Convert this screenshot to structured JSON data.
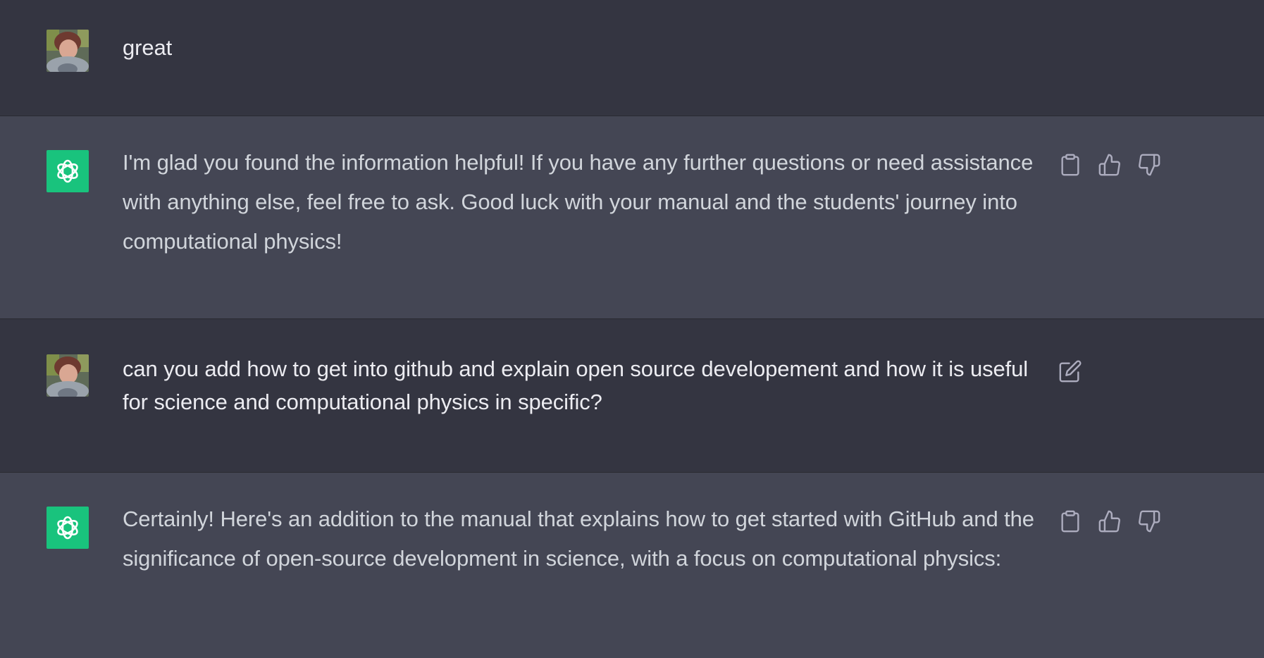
{
  "conversation": {
    "messages": [
      {
        "role": "user",
        "text": "great"
      },
      {
        "role": "assistant",
        "text": "I'm glad you found the information helpful! If you have any further questions or need assistance with anything else, feel free to ask. Good luck with your manual and the students' journey into computational physics!"
      },
      {
        "role": "user",
        "text": "can you add how to get into github and explain open source developement and how it is useful for science and computational physics in specific?"
      },
      {
        "role": "assistant",
        "text": "Certainly! Here's an addition to the manual that explains how to get started with GitHub and the significance of open-source development in science, with a focus on computational physics:"
      }
    ]
  },
  "icons": {
    "user_avatar": "user-avatar",
    "assistant_avatar": "openai-logo-icon",
    "copy": "clipboard-icon",
    "like": "thumbs-up-icon",
    "dislike": "thumbs-down-icon",
    "edit": "edit-icon"
  },
  "colors": {
    "user_bg": "#343541",
    "assistant_bg": "#444654",
    "brand_green": "#19c37d",
    "icon": "#acacbe"
  }
}
